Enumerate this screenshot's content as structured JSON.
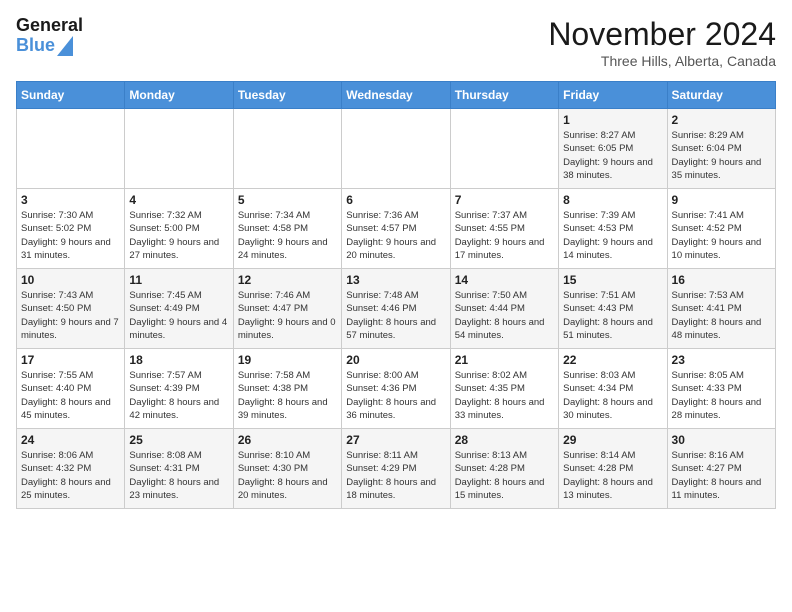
{
  "header": {
    "logo_line1": "General",
    "logo_line2": "Blue",
    "month_title": "November 2024",
    "location": "Three Hills, Alberta, Canada"
  },
  "days_of_week": [
    "Sunday",
    "Monday",
    "Tuesday",
    "Wednesday",
    "Thursday",
    "Friday",
    "Saturday"
  ],
  "weeks": [
    [
      {
        "day": "",
        "info": ""
      },
      {
        "day": "",
        "info": ""
      },
      {
        "day": "",
        "info": ""
      },
      {
        "day": "",
        "info": ""
      },
      {
        "day": "",
        "info": ""
      },
      {
        "day": "1",
        "info": "Sunrise: 8:27 AM\nSunset: 6:05 PM\nDaylight: 9 hours and 38 minutes."
      },
      {
        "day": "2",
        "info": "Sunrise: 8:29 AM\nSunset: 6:04 PM\nDaylight: 9 hours and 35 minutes."
      }
    ],
    [
      {
        "day": "3",
        "info": "Sunrise: 7:30 AM\nSunset: 5:02 PM\nDaylight: 9 hours and 31 minutes."
      },
      {
        "day": "4",
        "info": "Sunrise: 7:32 AM\nSunset: 5:00 PM\nDaylight: 9 hours and 27 minutes."
      },
      {
        "day": "5",
        "info": "Sunrise: 7:34 AM\nSunset: 4:58 PM\nDaylight: 9 hours and 24 minutes."
      },
      {
        "day": "6",
        "info": "Sunrise: 7:36 AM\nSunset: 4:57 PM\nDaylight: 9 hours and 20 minutes."
      },
      {
        "day": "7",
        "info": "Sunrise: 7:37 AM\nSunset: 4:55 PM\nDaylight: 9 hours and 17 minutes."
      },
      {
        "day": "8",
        "info": "Sunrise: 7:39 AM\nSunset: 4:53 PM\nDaylight: 9 hours and 14 minutes."
      },
      {
        "day": "9",
        "info": "Sunrise: 7:41 AM\nSunset: 4:52 PM\nDaylight: 9 hours and 10 minutes."
      }
    ],
    [
      {
        "day": "10",
        "info": "Sunrise: 7:43 AM\nSunset: 4:50 PM\nDaylight: 9 hours and 7 minutes."
      },
      {
        "day": "11",
        "info": "Sunrise: 7:45 AM\nSunset: 4:49 PM\nDaylight: 9 hours and 4 minutes."
      },
      {
        "day": "12",
        "info": "Sunrise: 7:46 AM\nSunset: 4:47 PM\nDaylight: 9 hours and 0 minutes."
      },
      {
        "day": "13",
        "info": "Sunrise: 7:48 AM\nSunset: 4:46 PM\nDaylight: 8 hours and 57 minutes."
      },
      {
        "day": "14",
        "info": "Sunrise: 7:50 AM\nSunset: 4:44 PM\nDaylight: 8 hours and 54 minutes."
      },
      {
        "day": "15",
        "info": "Sunrise: 7:51 AM\nSunset: 4:43 PM\nDaylight: 8 hours and 51 minutes."
      },
      {
        "day": "16",
        "info": "Sunrise: 7:53 AM\nSunset: 4:41 PM\nDaylight: 8 hours and 48 minutes."
      }
    ],
    [
      {
        "day": "17",
        "info": "Sunrise: 7:55 AM\nSunset: 4:40 PM\nDaylight: 8 hours and 45 minutes."
      },
      {
        "day": "18",
        "info": "Sunrise: 7:57 AM\nSunset: 4:39 PM\nDaylight: 8 hours and 42 minutes."
      },
      {
        "day": "19",
        "info": "Sunrise: 7:58 AM\nSunset: 4:38 PM\nDaylight: 8 hours and 39 minutes."
      },
      {
        "day": "20",
        "info": "Sunrise: 8:00 AM\nSunset: 4:36 PM\nDaylight: 8 hours and 36 minutes."
      },
      {
        "day": "21",
        "info": "Sunrise: 8:02 AM\nSunset: 4:35 PM\nDaylight: 8 hours and 33 minutes."
      },
      {
        "day": "22",
        "info": "Sunrise: 8:03 AM\nSunset: 4:34 PM\nDaylight: 8 hours and 30 minutes."
      },
      {
        "day": "23",
        "info": "Sunrise: 8:05 AM\nSunset: 4:33 PM\nDaylight: 8 hours and 28 minutes."
      }
    ],
    [
      {
        "day": "24",
        "info": "Sunrise: 8:06 AM\nSunset: 4:32 PM\nDaylight: 8 hours and 25 minutes."
      },
      {
        "day": "25",
        "info": "Sunrise: 8:08 AM\nSunset: 4:31 PM\nDaylight: 8 hours and 23 minutes."
      },
      {
        "day": "26",
        "info": "Sunrise: 8:10 AM\nSunset: 4:30 PM\nDaylight: 8 hours and 20 minutes."
      },
      {
        "day": "27",
        "info": "Sunrise: 8:11 AM\nSunset: 4:29 PM\nDaylight: 8 hours and 18 minutes."
      },
      {
        "day": "28",
        "info": "Sunrise: 8:13 AM\nSunset: 4:28 PM\nDaylight: 8 hours and 15 minutes."
      },
      {
        "day": "29",
        "info": "Sunrise: 8:14 AM\nSunset: 4:28 PM\nDaylight: 8 hours and 13 minutes."
      },
      {
        "day": "30",
        "info": "Sunrise: 8:16 AM\nSunset: 4:27 PM\nDaylight: 8 hours and 11 minutes."
      }
    ]
  ]
}
